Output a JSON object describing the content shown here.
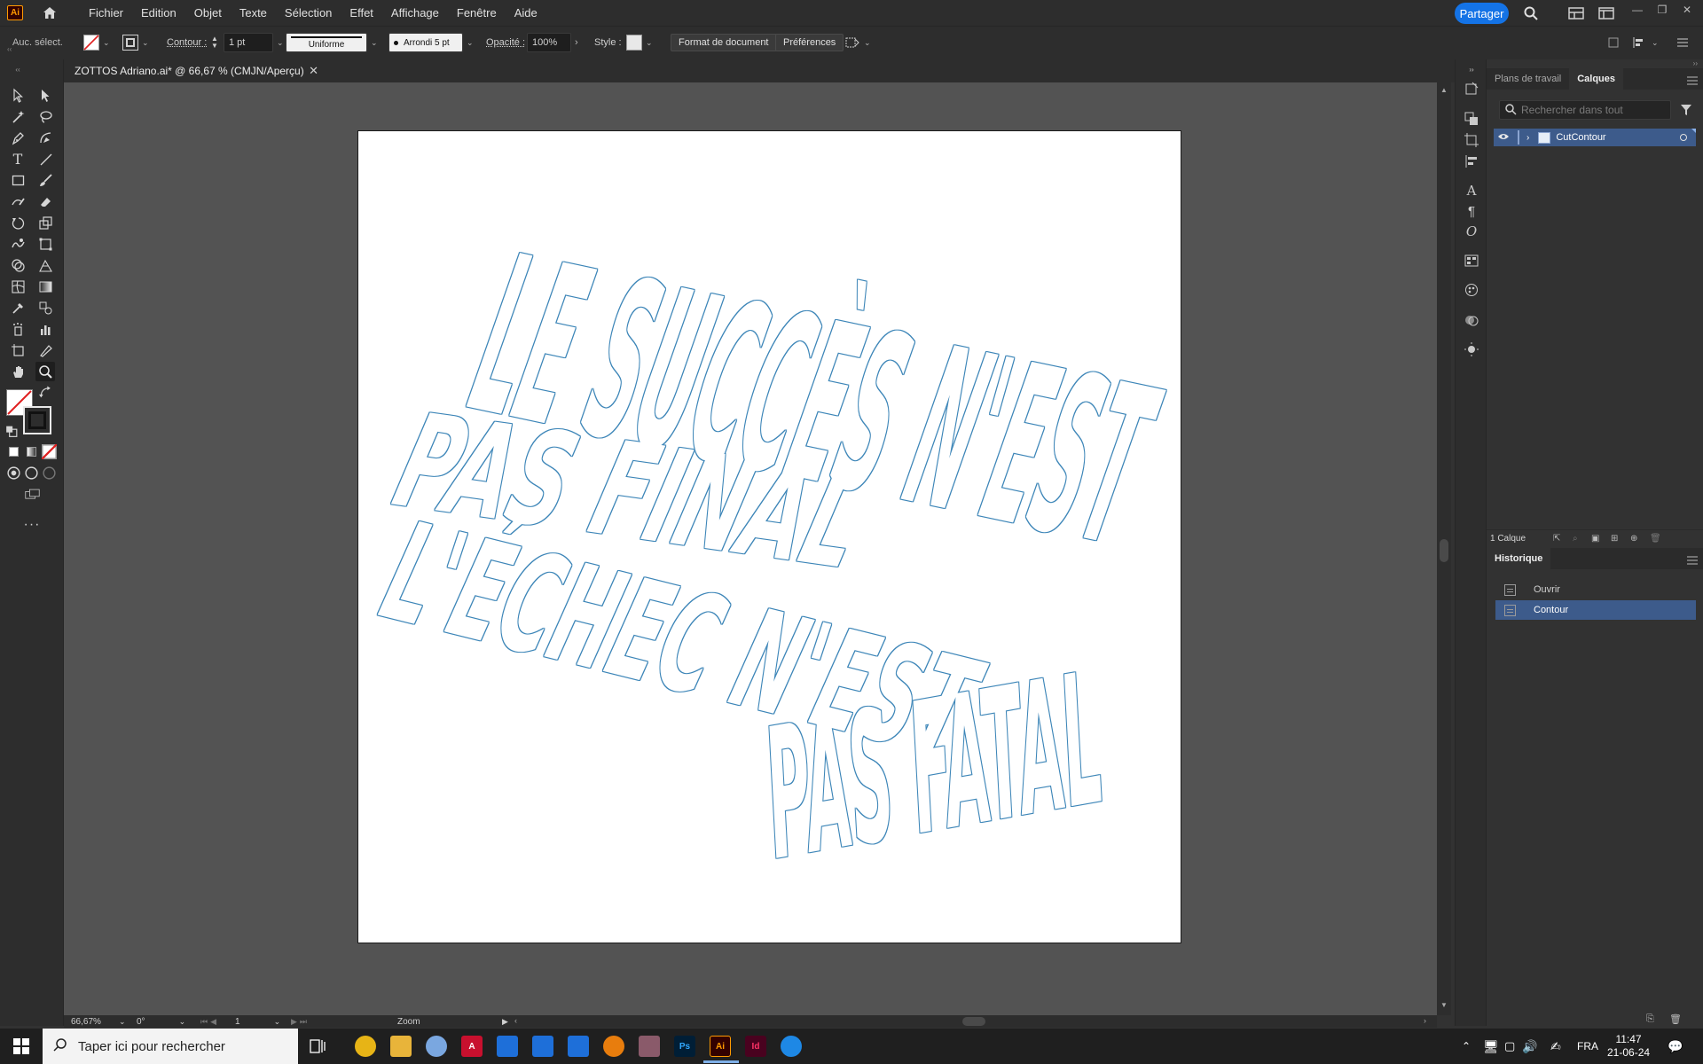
{
  "app": {
    "logo": "Ai"
  },
  "menu": [
    "Fichier",
    "Edition",
    "Objet",
    "Texte",
    "Sélection",
    "Effet",
    "Affichage",
    "Fenêtre",
    "Aide"
  ],
  "share_label": "Partager",
  "control": {
    "selection": "Auc. sélect.",
    "contour_label": "Contour :",
    "stroke_weight": "1 pt",
    "profile": "Uniforme",
    "brush": "Arrondi 5 pt",
    "opacity_label": "Opacité :",
    "opacity_value": "100%",
    "style_label": "Style :",
    "doc_format": "Format de document",
    "preferences": "Préférences"
  },
  "document": {
    "tab_title": "ZOTTOS Adriano.ai* @ 66,67 % (CMJN/Aperçu)"
  },
  "artwork": {
    "stroke_color": "#3e86b8",
    "lines": [
      "LE SUCCÈS N'EST",
      "PAS FINAL",
      "L'ÉCHEC N'EST",
      "PAS FATAL"
    ]
  },
  "statusbar": {
    "zoom": "66,67%",
    "rotation": "0°",
    "artboard": "1",
    "tool": "Zoom"
  },
  "panels": {
    "layers_tabs": [
      "Plans de travail",
      "Calques"
    ],
    "search_placeholder": "Rechercher dans tout",
    "layers": [
      {
        "name": "CutContour"
      }
    ],
    "layer_count": "1 Calque",
    "history_title": "Historique",
    "history": [
      {
        "label": "Ouvrir",
        "active": false
      },
      {
        "label": "Contour",
        "active": true
      }
    ]
  },
  "taskbar": {
    "search_placeholder": "Taper ici pour rechercher",
    "apps": [
      {
        "name": "chrome-icon",
        "color": "#e7b416",
        "label": ""
      },
      {
        "name": "file-explorer-icon",
        "color": "#e8b43a",
        "label": ""
      },
      {
        "name": "paint-icon",
        "color": "#7aa7e0",
        "label": ""
      },
      {
        "name": "acrobat-icon",
        "color": "#c8102e",
        "label": "A"
      },
      {
        "name": "app-blue-icon-1",
        "color": "#1e6fd9",
        "label": ""
      },
      {
        "name": "app-blue-icon-2",
        "color": "#1e6fd9",
        "label": ""
      },
      {
        "name": "app-blue-icon-3",
        "color": "#1e6fd9",
        "label": ""
      },
      {
        "name": "blender-icon",
        "color": "#e87d0d",
        "label": ""
      },
      {
        "name": "app-hex-icon",
        "color": "#8a5a6a",
        "label": ""
      },
      {
        "name": "photoshop-icon",
        "color": "#001e36",
        "label": "Ps"
      },
      {
        "name": "illustrator-icon",
        "color": "#330000",
        "label": "Ai"
      },
      {
        "name": "indesign-icon",
        "color": "#49021f",
        "label": "Id"
      },
      {
        "name": "edge-icon",
        "color": "#1e88e5",
        "label": ""
      }
    ],
    "lang": "FRA",
    "time": "11:47",
    "date": "21-06-24"
  }
}
